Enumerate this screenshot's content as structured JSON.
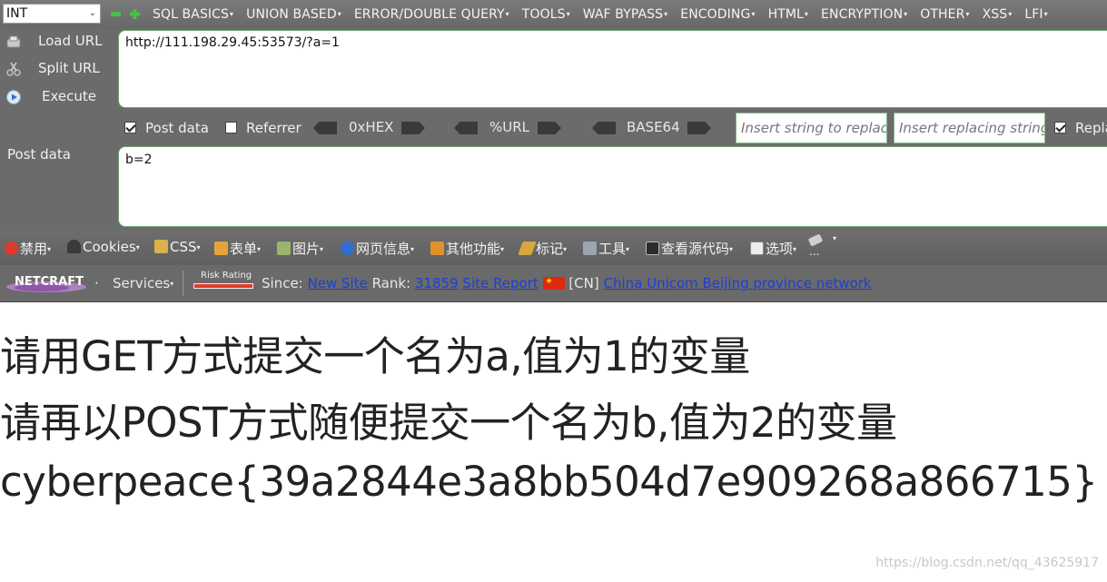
{
  "hackbar": {
    "type_select": "INT",
    "menu": [
      "SQL BASICS",
      "UNION BASED",
      "ERROR/DOUBLE QUERY",
      "TOOLS",
      "WAF BYPASS",
      "ENCODING",
      "HTML",
      "ENCRYPTION",
      "OTHER",
      "XSS",
      "LFI"
    ],
    "buttons": {
      "load": "Load URL",
      "split": "Split URL",
      "execute": "Execute"
    },
    "url_value": "http://111.198.29.45:53573/?a=1",
    "options": {
      "post_data": "Post data",
      "referrer": "Referrer",
      "hex": "0xHEX",
      "url": "%URL",
      "base64": "BASE64",
      "replace_find_placeholder": "Insert string to replace",
      "replace_with_placeholder": "Insert replacing string",
      "replace_all": "Replace All"
    },
    "post_label": "Post data",
    "post_value": "b=2"
  },
  "webdev": {
    "items": [
      "禁用",
      "Cookies",
      "CSS",
      "表单",
      "图片",
      "网页信息",
      "其他功能",
      "标记",
      "工具",
      "查看源代码",
      "选项"
    ],
    "overflow": "..."
  },
  "netcraft": {
    "logo": "NETCRAFT",
    "services": "Services",
    "risk_rating": "Risk Rating",
    "since_label": "Since:",
    "since_value": "New Site",
    "rank_label": "Rank:",
    "rank_value": "31859",
    "site_report": "Site Report",
    "country": "[CN]",
    "network": "China Unicom Beijing province network"
  },
  "page": {
    "line1": "请用GET方式提交一个名为a,值为1的变量",
    "line2": "请再以POST方式随便提交一个名为b,值为2的变量",
    "line3": "cyberpeace{39a2844e3a8bb504d7e909268a866715}"
  },
  "watermark": "https://blog.csdn.net/qq_43625917",
  "colors": {
    "toolbar_gray": "#6b6b6b",
    "input_border": "#6aa56a",
    "link_blue": "#1b3fd8",
    "page_text": "#222222"
  }
}
